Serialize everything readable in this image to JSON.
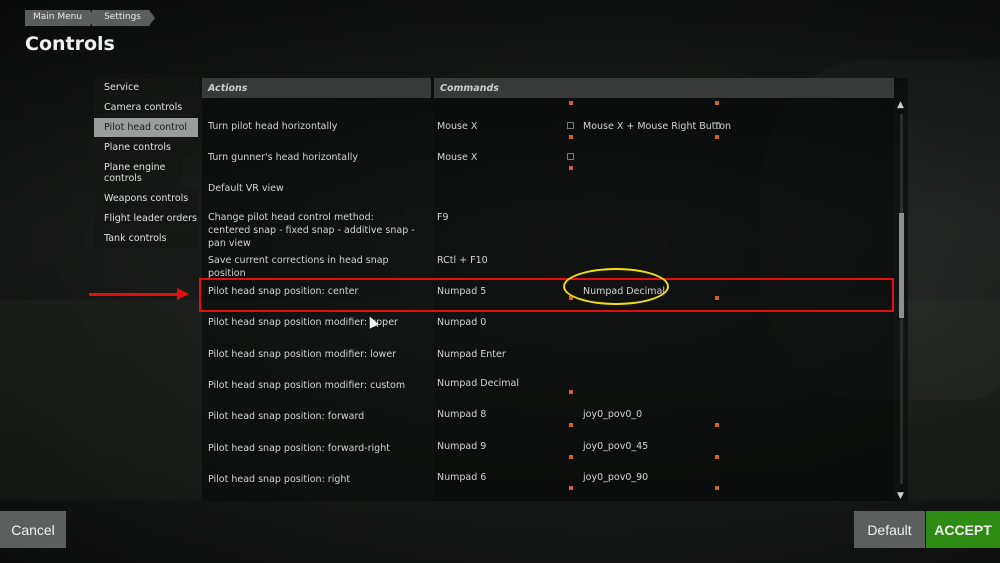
{
  "breadcrumb": {
    "items": [
      "Main Menu",
      "Settings"
    ]
  },
  "page_title": "Controls",
  "sidebar": {
    "items": [
      {
        "label": "Service",
        "active": false
      },
      {
        "label": "Camera controls",
        "active": false
      },
      {
        "label": "Pilot head control",
        "active": true
      },
      {
        "label": "Plane controls",
        "active": false
      },
      {
        "label": "Plane engine controls",
        "active": false
      },
      {
        "label": "Weapons controls",
        "active": false
      },
      {
        "label": "Flight leader orders",
        "active": false
      },
      {
        "label": "Tank controls",
        "active": false
      }
    ]
  },
  "table": {
    "headers": {
      "actions": "Actions",
      "commands": "Commands"
    },
    "rows": [
      {
        "action": "Turn pilot head horizontally",
        "cmd1": "Mouse X",
        "cmd2": "Mouse X + Mouse Right Button"
      },
      {
        "action": "Turn gunner's head horizontally",
        "cmd1": "Mouse X",
        "cmd2": ""
      },
      {
        "action": "Default VR view",
        "cmd1": "",
        "cmd2": ""
      },
      {
        "action": "Change pilot head control method: centered snap - fixed snap - additive snap - pan view",
        "cmd1": "F9",
        "cmd2": ""
      },
      {
        "action": "Save current corrections in head snap position",
        "cmd1": "RCtl + F10",
        "cmd2": ""
      },
      {
        "action": "Pilot head snap position: center",
        "cmd1": "Numpad 5",
        "cmd2": "Numpad Decimal"
      },
      {
        "action": "Pilot head snap position modifier: upper",
        "cmd1": "Numpad 0",
        "cmd2": ""
      },
      {
        "action": "Pilot head snap position modifier: lower",
        "cmd1": "Numpad Enter",
        "cmd2": ""
      },
      {
        "action": "Pilot head snap position modifier: custom",
        "cmd1": "Numpad Decimal",
        "cmd2": ""
      },
      {
        "action": "Pilot head snap position: forward",
        "cmd1": "Numpad 8",
        "cmd2": "joy0_pov0_0"
      },
      {
        "action": "Pilot head snap position: forward-right",
        "cmd1": "Numpad 9",
        "cmd2": "joy0_pov0_45"
      },
      {
        "action": "Pilot head snap position: right",
        "cmd1": "Numpad 6",
        "cmd2": "joy0_pov0_90"
      }
    ]
  },
  "scrollbar": {
    "up_icon": "▲",
    "down_icon": "▼"
  },
  "buttons": {
    "cancel": "Cancel",
    "default": "Default",
    "accept": "ACCEPT"
  },
  "colors": {
    "accent_accept": "#2e8b14",
    "highlight_row": "#e01010",
    "highlight_ellipse": "#f0e010",
    "binding_marker": "#d2641f"
  }
}
